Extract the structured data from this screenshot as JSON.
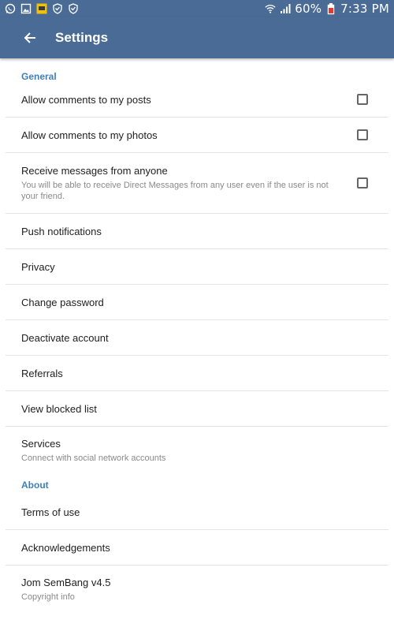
{
  "status_bar": {
    "battery_percent": "60%",
    "time": "7:33 PM",
    "icons": [
      "whatsapp-icon",
      "gallery-icon",
      "app-icon",
      "shield-icon",
      "shield-icon",
      "wifi-icon",
      "signal-icon",
      "battery-icon"
    ]
  },
  "app_bar": {
    "title": "Settings",
    "color": "#4a6b95"
  },
  "sections": {
    "general": {
      "title": "General",
      "allow_comments_posts": "Allow comments to my posts",
      "allow_comments_photos": "Allow comments to my photos",
      "receive_messages": "Receive messages from anyone",
      "receive_messages_desc": "You will be able to receive Direct Messages from any user even if the user is not your friend.",
      "push_notifications": "Push notifications",
      "privacy": "Privacy",
      "change_password": "Change password",
      "deactivate_account": "Deactivate account",
      "referrals": "Referrals",
      "view_blocked_list": "View blocked list",
      "services": "Services",
      "services_desc": "Connect with social network accounts"
    },
    "about": {
      "title": "About",
      "terms_of_use": "Terms of use",
      "acknowledgements": "Acknowledgements",
      "version": "Jom SemBang v4.5",
      "version_desc": "Copyright info"
    }
  },
  "colors": {
    "accent": "#3f7fb8",
    "divider": "#e4e4e4"
  }
}
